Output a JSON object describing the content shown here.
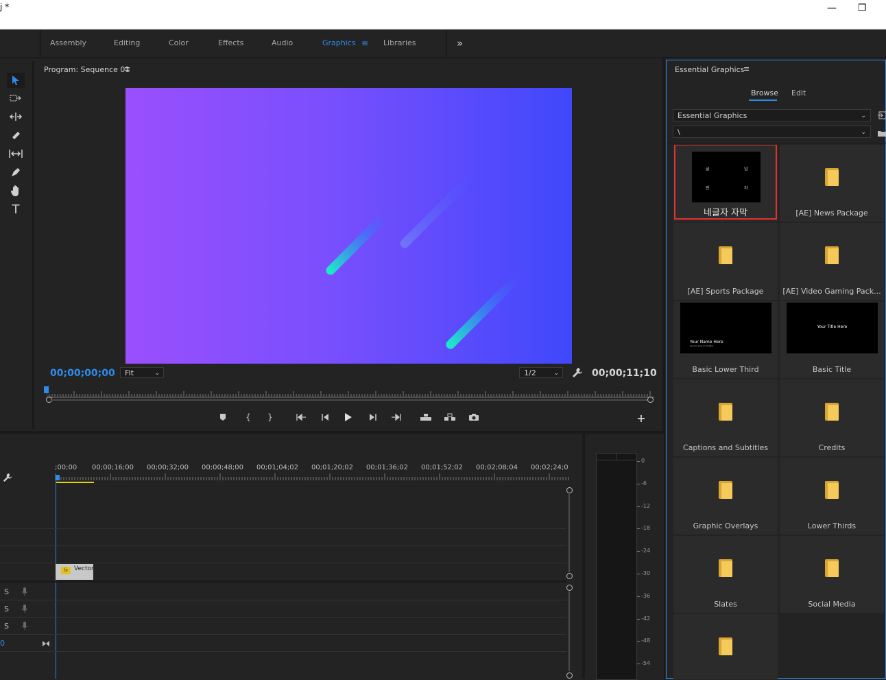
{
  "window": {
    "title": "j *",
    "minimize_glyph": "—",
    "restore_glyph": "❐"
  },
  "workspaces": {
    "tabs": [
      "Assembly",
      "Editing",
      "Color",
      "Effects",
      "Audio",
      "Graphics",
      "Libraries"
    ],
    "active": "Graphics",
    "more_glyph": "»"
  },
  "tools": [
    "selection-tool-icon",
    "track-select-icon",
    "ripple-edit-icon",
    "razor-icon",
    "slip-icon",
    "pen-icon",
    "hand-icon",
    "type-icon"
  ],
  "program_monitor": {
    "label": "Program: Sequence 01",
    "menu_glyph": "≡",
    "current_timecode": "00;00;00;00",
    "duration_timecode": "00;00;11;10",
    "fit_select": "Fit",
    "resolution_select": "1/2",
    "accent_color": "#2d8ceb"
  },
  "timeline": {
    "ruler_labels": [
      ";00;00",
      "00;00;16;00",
      "00;00;32;00",
      "00;00;48;00",
      "00;01;04;02",
      "00;01;20;02",
      "00;01;36;02",
      "00;01;52;02",
      "00;02;08;04",
      "00;02;24;0"
    ],
    "clip_label": "Vector",
    "clip_badge": "fx",
    "track_labels": [
      "S",
      "S",
      "S"
    ],
    "bottom_value": "0"
  },
  "audio_meter": {
    "scale": [
      "0",
      "-6",
      "-12",
      "-18",
      "-24",
      "-30",
      "-36",
      "-42",
      "-48",
      "-54"
    ]
  },
  "essential_graphics": {
    "title": "Essential Graphics",
    "menu_glyph": "≡",
    "tabs": [
      "Browse",
      "Edit"
    ],
    "active_tab": "Browse",
    "source_select": "Essential Graphics",
    "path_select": "\\",
    "items": [
      {
        "name": "네글자 자막",
        "kind": "template-korean",
        "selected": true,
        "thumb_chars": [
          "글",
          "넘",
          "란",
          "자"
        ]
      },
      {
        "name": "[AE] News Package",
        "kind": "folder"
      },
      {
        "name": "[AE] Sports Package",
        "kind": "folder"
      },
      {
        "name": "[AE] Video Gaming Pack...",
        "kind": "folder"
      },
      {
        "name": "Basic Lower Third",
        "kind": "template-lower-third",
        "thumb_text": "Your Name Here",
        "thumb_subtext": "Second Line in Smaller"
      },
      {
        "name": "Basic Title",
        "kind": "template-title",
        "thumb_text": "Your Title Here"
      },
      {
        "name": "Captions and Subtitles",
        "kind": "folder"
      },
      {
        "name": "Credits",
        "kind": "folder"
      },
      {
        "name": "Graphic Overlays",
        "kind": "folder"
      },
      {
        "name": "Lower Thirds",
        "kind": "folder"
      },
      {
        "name": "Slates",
        "kind": "folder"
      },
      {
        "name": "Social Media",
        "kind": "folder"
      },
      {
        "name": "",
        "kind": "folder"
      }
    ],
    "highlight_color": "#e0312c"
  }
}
